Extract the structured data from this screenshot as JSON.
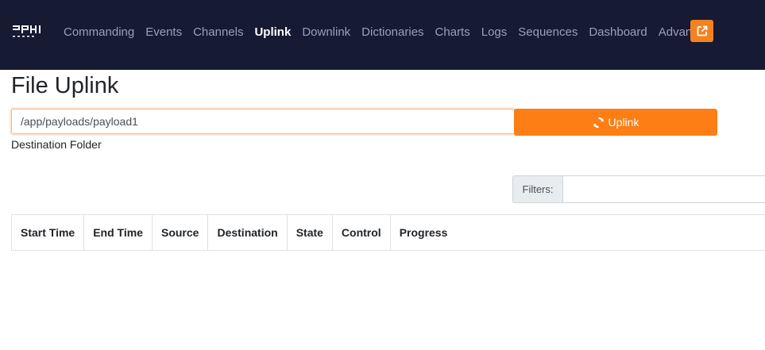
{
  "navbar": {
    "logo_icon": "fprime-logo-icon",
    "items": [
      {
        "label": "Commanding",
        "active": false
      },
      {
        "label": "Events",
        "active": false
      },
      {
        "label": "Channels",
        "active": false
      },
      {
        "label": "Uplink",
        "active": true
      },
      {
        "label": "Downlink",
        "active": false
      },
      {
        "label": "Dictionaries",
        "active": false
      },
      {
        "label": "Charts",
        "active": false
      },
      {
        "label": "Logs",
        "active": false
      },
      {
        "label": "Sequences",
        "active": false
      },
      {
        "label": "Dashboard",
        "active": false
      },
      {
        "label": "Advanced",
        "active": false
      }
    ],
    "external_icon": "external-link-icon",
    "colors": {
      "background": "#161a33",
      "accent": "#f58220"
    }
  },
  "page": {
    "title": "File Uplink",
    "destination": {
      "value": "/app/payloads/payload1",
      "label": "Destination Folder"
    },
    "uplink_button": {
      "label": "Uplink",
      "icon": "sync-icon"
    },
    "filters": {
      "label": "Filters:",
      "value": ""
    },
    "table": {
      "columns": [
        "Start Time",
        "End Time",
        "Source",
        "Destination",
        "State",
        "Control",
        "Progress"
      ],
      "rows": []
    }
  }
}
